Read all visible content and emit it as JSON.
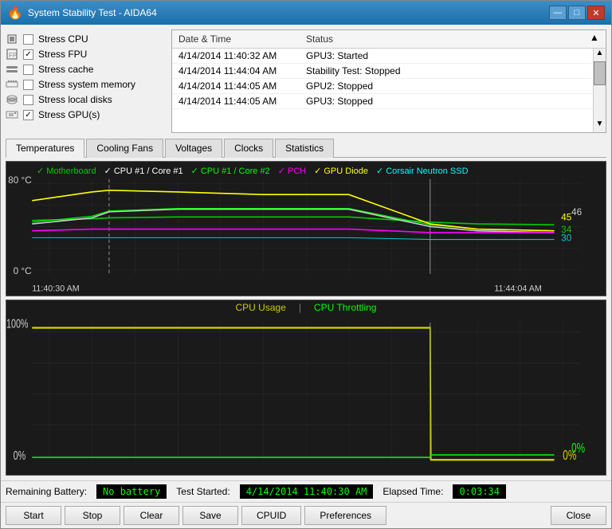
{
  "window": {
    "title": "System Stability Test - AIDA64",
    "icon": "🔥"
  },
  "titlebar": {
    "minimize": "—",
    "maximize": "□",
    "close": "✕"
  },
  "stress_options": [
    {
      "id": "cpu",
      "label": "Stress CPU",
      "checked": false,
      "icon": "cpu"
    },
    {
      "id": "fpu",
      "label": "Stress FPU",
      "checked": true,
      "icon": "fpu"
    },
    {
      "id": "cache",
      "label": "Stress cache",
      "checked": false,
      "icon": "cache"
    },
    {
      "id": "memory",
      "label": "Stress system memory",
      "checked": false,
      "icon": "memory"
    },
    {
      "id": "disks",
      "label": "Stress local disks",
      "checked": false,
      "icon": "disk"
    },
    {
      "id": "gpu",
      "label": "Stress GPU(s)",
      "checked": true,
      "icon": "gpu"
    }
  ],
  "log": {
    "columns": [
      "Date & Time",
      "Status"
    ],
    "rows": [
      {
        "time": "4/14/2014 11:40:32 AM",
        "status": "GPU3: Started"
      },
      {
        "time": "4/14/2014 11:44:04 AM",
        "status": "Stability Test: Stopped"
      },
      {
        "time": "4/14/2014 11:44:05 AM",
        "status": "GPU2: Stopped"
      },
      {
        "time": "4/14/2014 11:44:05 AM",
        "status": "GPU3: Stopped"
      }
    ]
  },
  "tabs": [
    "Temperatures",
    "Cooling Fans",
    "Voltages",
    "Clocks",
    "Statistics"
  ],
  "active_tab": "Temperatures",
  "temp_graph": {
    "y_max": "80 °C",
    "y_min": "0 °C",
    "x_start": "11:40:30 AM",
    "x_end": "11:44:04 AM",
    "legend": [
      {
        "label": "Motherboard",
        "color": "#00cc00"
      },
      {
        "label": "CPU #1 / Core #1",
        "color": "#ffffff"
      },
      {
        "label": "CPU #1 / Core #2",
        "color": "#00ff00"
      },
      {
        "label": "PCH",
        "color": "#ff00ff"
      },
      {
        "label": "GPU Diode",
        "color": "#ffff00"
      },
      {
        "label": "Corsair Neutron SSD",
        "color": "#00ffff"
      }
    ],
    "values_right": [
      "45",
      "46",
      "34",
      "30"
    ]
  },
  "cpu_graph": {
    "legend": [
      {
        "label": "CPU Usage",
        "color": "#cccc00"
      },
      {
        "label": "CPU Throttling",
        "color": "#00ff00"
      }
    ],
    "y_max": "100%",
    "y_min": "0%",
    "values_right": [
      "0%",
      "0%"
    ]
  },
  "status": {
    "battery_label": "Remaining Battery:",
    "battery_value": "No battery",
    "test_started_label": "Test Started:",
    "test_started_value": "4/14/2014 11:40:30 AM",
    "elapsed_label": "Elapsed Time:",
    "elapsed_value": "0:03:34"
  },
  "buttons": {
    "start": "Start",
    "stop": "Stop",
    "clear": "Clear",
    "save": "Save",
    "cpuid": "CPUID",
    "preferences": "Preferences",
    "close": "Close"
  }
}
